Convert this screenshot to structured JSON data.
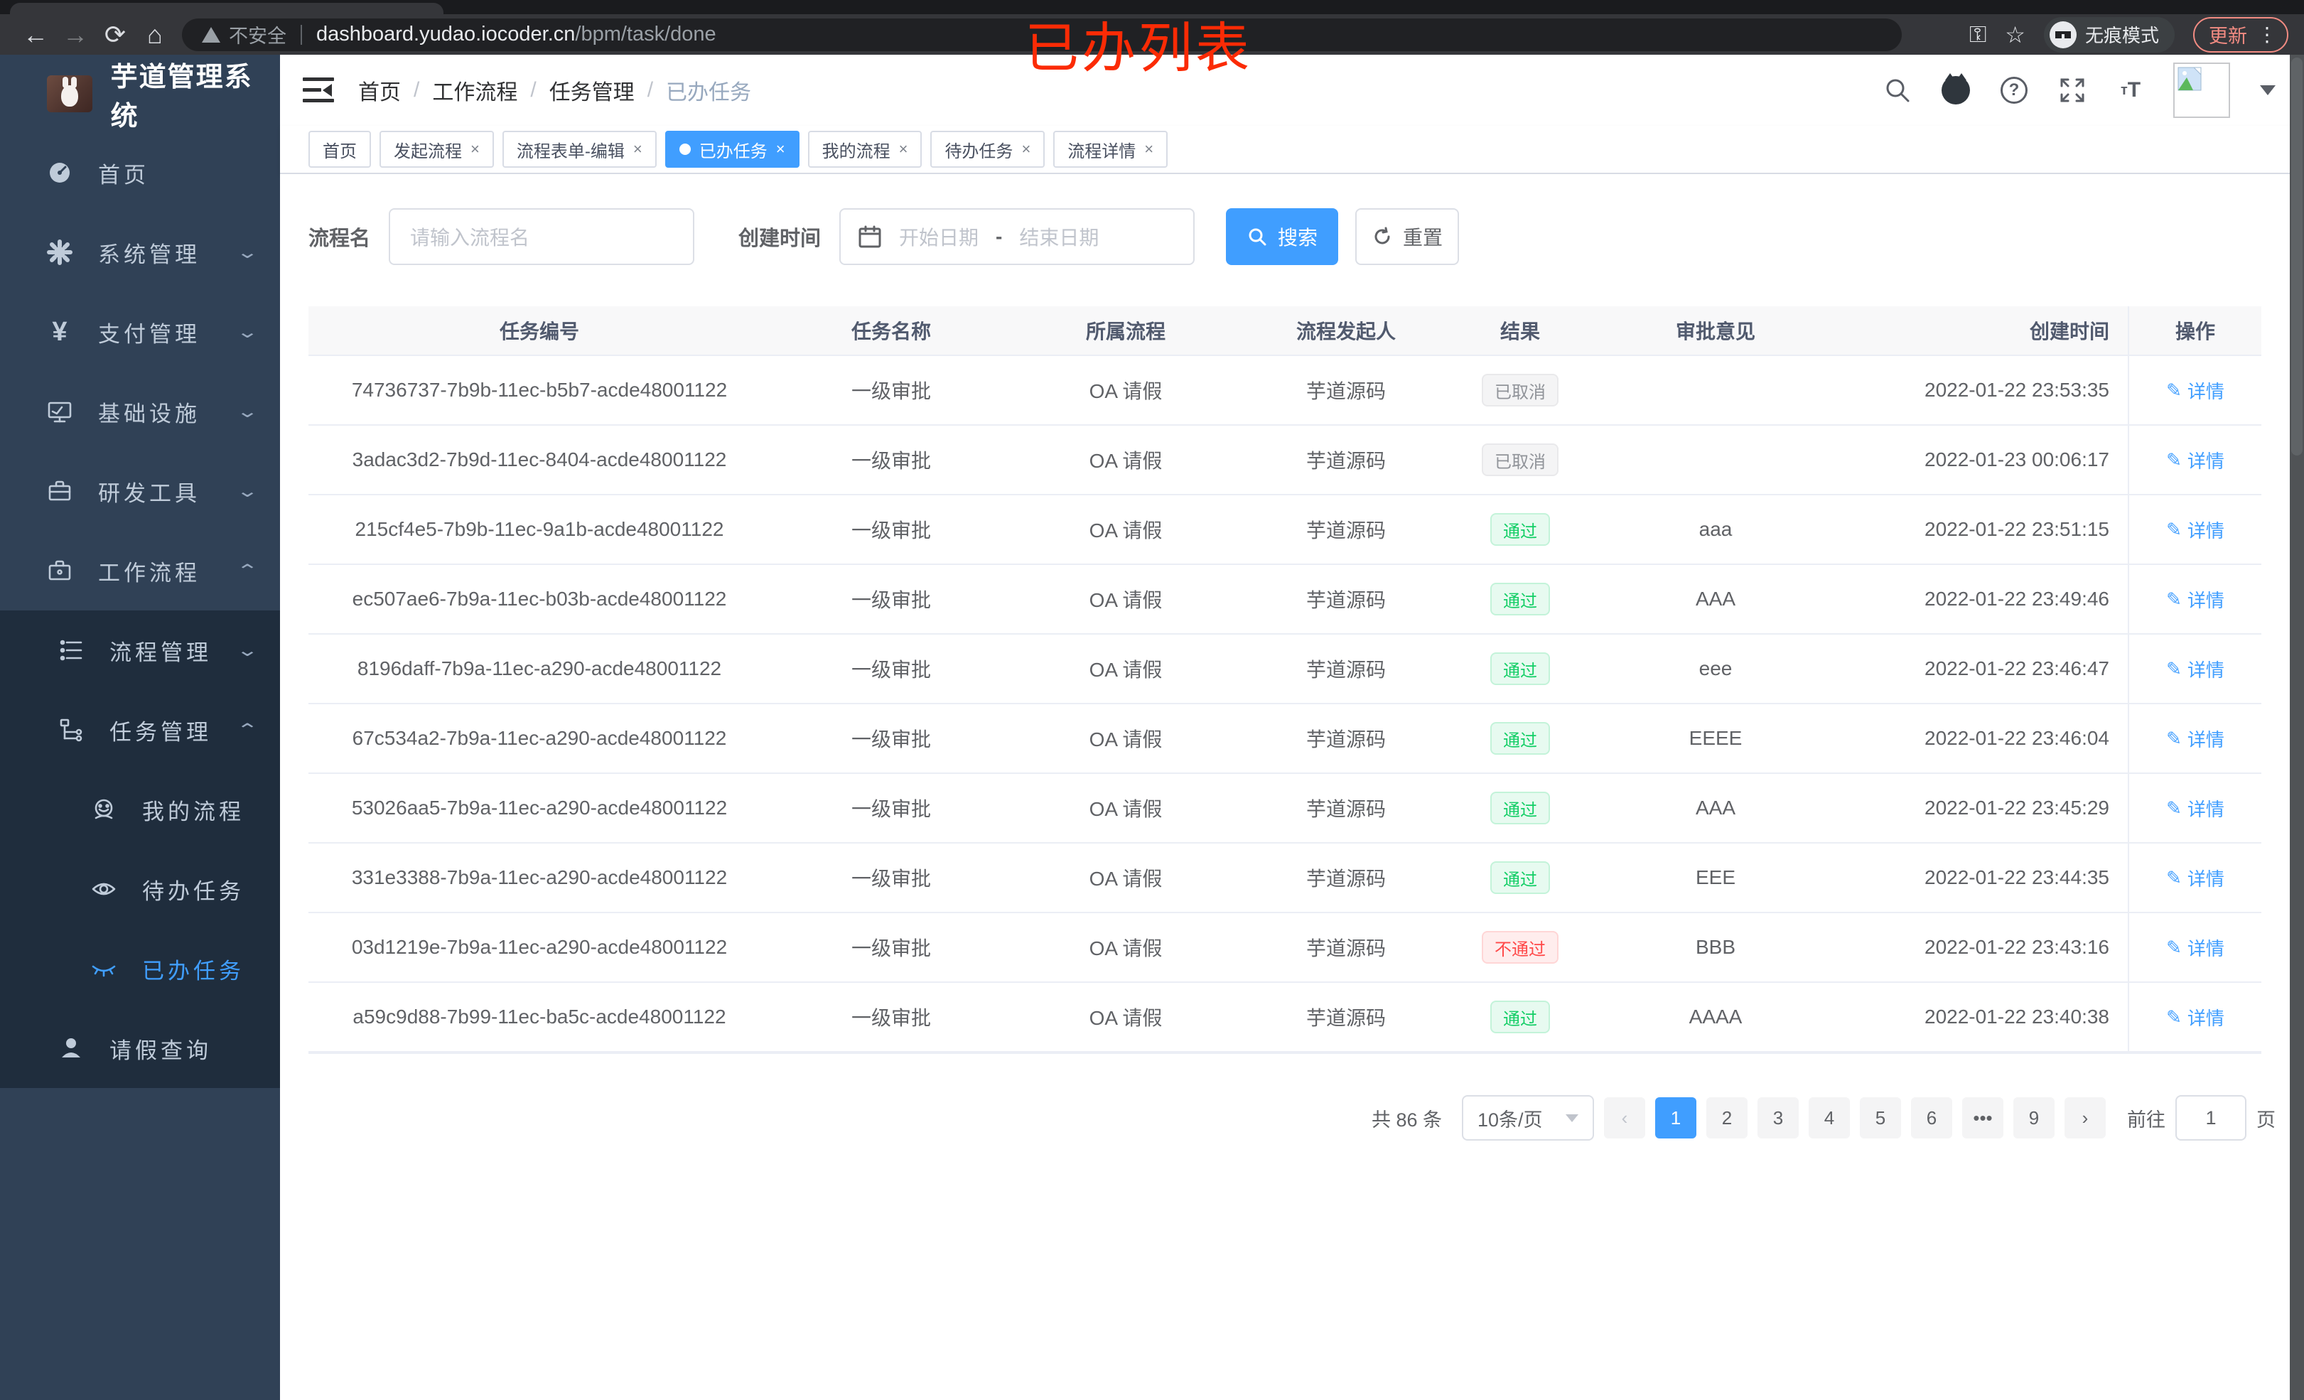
{
  "browser": {
    "security_label": "不安全",
    "url_host": "dashboard.yudao.iocoder.cn",
    "url_path": "/bpm/task/done",
    "incognito_label": "无痕模式",
    "update_label": "更新",
    "kebab_glyph": "⋮",
    "back_glyph": "←",
    "forward_glyph": "→",
    "reload_glyph": "⟳",
    "home_glyph": "⌂",
    "key_glyph": "⚿",
    "star_glyph": "☆"
  },
  "annotation": "已办列表",
  "sidebar": {
    "title": "芋道管理系统",
    "menu": [
      {
        "label": "首页"
      },
      {
        "label": "系统管理"
      },
      {
        "label": "支付管理"
      },
      {
        "label": "基础设施"
      },
      {
        "label": "研发工具"
      },
      {
        "label": "工作流程"
      }
    ],
    "submenu": [
      {
        "label": "流程管理"
      },
      {
        "label": "任务管理"
      }
    ],
    "nested": [
      {
        "label": "我的流程"
      },
      {
        "label": "待办任务"
      },
      {
        "label": "已办任务"
      },
      {
        "label": "请假查询"
      }
    ],
    "yen_glyph": "¥"
  },
  "header": {
    "breadcrumb": [
      "首页",
      "工作流程",
      "任务管理",
      "已办任务"
    ],
    "breadcrumb_sep": "/",
    "font_icon_small": "т",
    "font_icon_big": "T",
    "help_glyph": "?"
  },
  "tabs": {
    "close_glyph": "×",
    "items": [
      {
        "label": "首页"
      },
      {
        "label": "发起流程"
      },
      {
        "label": "流程表单-编辑"
      },
      {
        "label": "已办任务"
      },
      {
        "label": "我的流程"
      },
      {
        "label": "待办任务"
      },
      {
        "label": "流程详情"
      }
    ]
  },
  "filters": {
    "name_label": "流程名",
    "name_placeholder": "请输入流程名",
    "time_label": "创建时间",
    "start_placeholder": "开始日期",
    "range_separator": "-",
    "end_placeholder": "结束日期",
    "search_label": "搜索",
    "reset_label": "重置"
  },
  "table": {
    "columns": [
      "任务编号",
      "任务名称",
      "所属流程",
      "流程发起人",
      "结果",
      "审批意见",
      "创建时间",
      "操作"
    ],
    "action_label": "详情",
    "action_glyph": "✎",
    "rows": [
      {
        "id": "74736737-7b9b-11ec-b5b7-acde48001122",
        "name": "一级审批",
        "process": "OA 请假",
        "starter": "芋道源码",
        "result": "已取消",
        "comment": "",
        "time": "2022-01-22 23:53:35"
      },
      {
        "id": "3adac3d2-7b9d-11ec-8404-acde48001122",
        "name": "一级审批",
        "process": "OA 请假",
        "starter": "芋道源码",
        "result": "已取消",
        "comment": "",
        "time": "2022-01-23 00:06:17"
      },
      {
        "id": "215cf4e5-7b9b-11ec-9a1b-acde48001122",
        "name": "一级审批",
        "process": "OA 请假",
        "starter": "芋道源码",
        "result": "通过",
        "comment": "aaa",
        "time": "2022-01-22 23:51:15"
      },
      {
        "id": "ec507ae6-7b9a-11ec-b03b-acde48001122",
        "name": "一级审批",
        "process": "OA 请假",
        "starter": "芋道源码",
        "result": "通过",
        "comment": "AAA",
        "time": "2022-01-22 23:49:46"
      },
      {
        "id": "8196daff-7b9a-11ec-a290-acde48001122",
        "name": "一级审批",
        "process": "OA 请假",
        "starter": "芋道源码",
        "result": "通过",
        "comment": "eee",
        "time": "2022-01-22 23:46:47"
      },
      {
        "id": "67c534a2-7b9a-11ec-a290-acde48001122",
        "name": "一级审批",
        "process": "OA 请假",
        "starter": "芋道源码",
        "result": "通过",
        "comment": "EEEE",
        "time": "2022-01-22 23:46:04"
      },
      {
        "id": "53026aa5-7b9a-11ec-a290-acde48001122",
        "name": "一级审批",
        "process": "OA 请假",
        "starter": "芋道源码",
        "result": "通过",
        "comment": "AAA",
        "time": "2022-01-22 23:45:29"
      },
      {
        "id": "331e3388-7b9a-11ec-a290-acde48001122",
        "name": "一级审批",
        "process": "OA 请假",
        "starter": "芋道源码",
        "result": "通过",
        "comment": "EEE",
        "time": "2022-01-22 23:44:35"
      },
      {
        "id": "03d1219e-7b9a-11ec-a290-acde48001122",
        "name": "一级审批",
        "process": "OA 请假",
        "starter": "芋道源码",
        "result": "不通过",
        "comment": "BBB",
        "time": "2022-01-22 23:43:16"
      },
      {
        "id": "a59c9d88-7b99-11ec-ba5c-acde48001122",
        "name": "一级审批",
        "process": "OA 请假",
        "starter": "芋道源码",
        "result": "通过",
        "comment": "AAAA",
        "time": "2022-01-22 23:40:38"
      }
    ]
  },
  "pagination": {
    "total_label": "共 86 条",
    "page_size_label": "10条/页",
    "prev_glyph": "‹",
    "next_glyph": "›",
    "pages": [
      "1",
      "2",
      "3",
      "4",
      "5",
      "6",
      "•••",
      "9"
    ],
    "goto_label": "前往",
    "goto_value": "1",
    "unit_label": "页"
  },
  "colors": {
    "accent": "#409eff",
    "success": "#13ce66",
    "danger": "#ff4949",
    "info": "#909399",
    "sidebar_bg": "#304156",
    "submenu_bg": "#1f2d3d"
  }
}
